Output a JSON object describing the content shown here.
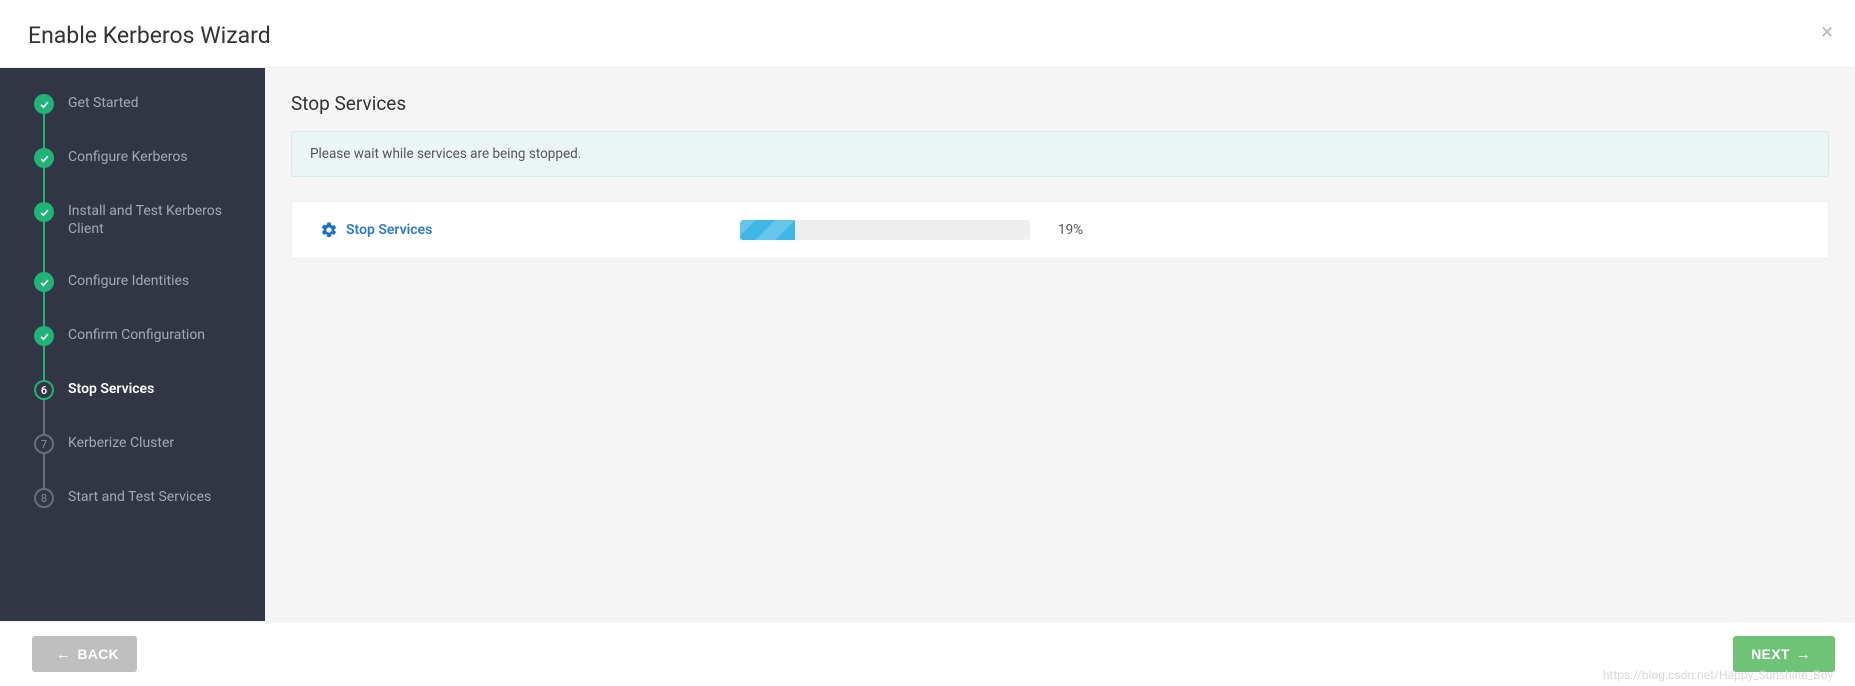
{
  "modal": {
    "title": "Enable Kerberos Wizard",
    "close_glyph": "×"
  },
  "sidebar": {
    "steps": [
      {
        "label": "Get Started",
        "status": "done"
      },
      {
        "label": "Configure Kerberos",
        "status": "done"
      },
      {
        "label": "Install and Test Kerberos Client",
        "status": "done"
      },
      {
        "label": "Configure Identities",
        "status": "done"
      },
      {
        "label": "Confirm Configuration",
        "status": "done"
      },
      {
        "label": "Stop Services",
        "status": "active",
        "number": "6"
      },
      {
        "label": "Kerberize Cluster",
        "status": "pending",
        "number": "7"
      },
      {
        "label": "Start and Test Services",
        "status": "pending",
        "number": "8"
      }
    ]
  },
  "main": {
    "heading": "Stop Services",
    "banner": "Please wait while services are being stopped.",
    "task": {
      "link_label": "Stop Services",
      "progress_pct": 19,
      "progress_text": "19%"
    }
  },
  "footer": {
    "back_label": "BACK",
    "next_label": "NEXT"
  },
  "watermark": "https://blog.csdn.net/Happy_Sunshine_Boy"
}
